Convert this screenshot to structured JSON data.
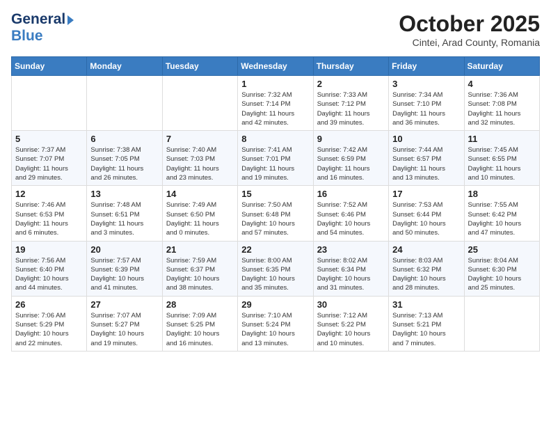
{
  "header": {
    "logo_general": "General",
    "logo_blue": "Blue",
    "month_title": "October 2025",
    "subtitle": "Cintei, Arad County, Romania"
  },
  "calendar": {
    "weekdays": [
      "Sunday",
      "Monday",
      "Tuesday",
      "Wednesday",
      "Thursday",
      "Friday",
      "Saturday"
    ],
    "weeks": [
      [
        {
          "day": "",
          "info": ""
        },
        {
          "day": "",
          "info": ""
        },
        {
          "day": "",
          "info": ""
        },
        {
          "day": "1",
          "info": "Sunrise: 7:32 AM\nSunset: 7:14 PM\nDaylight: 11 hours\nand 42 minutes."
        },
        {
          "day": "2",
          "info": "Sunrise: 7:33 AM\nSunset: 7:12 PM\nDaylight: 11 hours\nand 39 minutes."
        },
        {
          "day": "3",
          "info": "Sunrise: 7:34 AM\nSunset: 7:10 PM\nDaylight: 11 hours\nand 36 minutes."
        },
        {
          "day": "4",
          "info": "Sunrise: 7:36 AM\nSunset: 7:08 PM\nDaylight: 11 hours\nand 32 minutes."
        }
      ],
      [
        {
          "day": "5",
          "info": "Sunrise: 7:37 AM\nSunset: 7:07 PM\nDaylight: 11 hours\nand 29 minutes."
        },
        {
          "day": "6",
          "info": "Sunrise: 7:38 AM\nSunset: 7:05 PM\nDaylight: 11 hours\nand 26 minutes."
        },
        {
          "day": "7",
          "info": "Sunrise: 7:40 AM\nSunset: 7:03 PM\nDaylight: 11 hours\nand 23 minutes."
        },
        {
          "day": "8",
          "info": "Sunrise: 7:41 AM\nSunset: 7:01 PM\nDaylight: 11 hours\nand 19 minutes."
        },
        {
          "day": "9",
          "info": "Sunrise: 7:42 AM\nSunset: 6:59 PM\nDaylight: 11 hours\nand 16 minutes."
        },
        {
          "day": "10",
          "info": "Sunrise: 7:44 AM\nSunset: 6:57 PM\nDaylight: 11 hours\nand 13 minutes."
        },
        {
          "day": "11",
          "info": "Sunrise: 7:45 AM\nSunset: 6:55 PM\nDaylight: 11 hours\nand 10 minutes."
        }
      ],
      [
        {
          "day": "12",
          "info": "Sunrise: 7:46 AM\nSunset: 6:53 PM\nDaylight: 11 hours\nand 6 minutes."
        },
        {
          "day": "13",
          "info": "Sunrise: 7:48 AM\nSunset: 6:51 PM\nDaylight: 11 hours\nand 3 minutes."
        },
        {
          "day": "14",
          "info": "Sunrise: 7:49 AM\nSunset: 6:50 PM\nDaylight: 11 hours\nand 0 minutes."
        },
        {
          "day": "15",
          "info": "Sunrise: 7:50 AM\nSunset: 6:48 PM\nDaylight: 10 hours\nand 57 minutes."
        },
        {
          "day": "16",
          "info": "Sunrise: 7:52 AM\nSunset: 6:46 PM\nDaylight: 10 hours\nand 54 minutes."
        },
        {
          "day": "17",
          "info": "Sunrise: 7:53 AM\nSunset: 6:44 PM\nDaylight: 10 hours\nand 50 minutes."
        },
        {
          "day": "18",
          "info": "Sunrise: 7:55 AM\nSunset: 6:42 PM\nDaylight: 10 hours\nand 47 minutes."
        }
      ],
      [
        {
          "day": "19",
          "info": "Sunrise: 7:56 AM\nSunset: 6:40 PM\nDaylight: 10 hours\nand 44 minutes."
        },
        {
          "day": "20",
          "info": "Sunrise: 7:57 AM\nSunset: 6:39 PM\nDaylight: 10 hours\nand 41 minutes."
        },
        {
          "day": "21",
          "info": "Sunrise: 7:59 AM\nSunset: 6:37 PM\nDaylight: 10 hours\nand 38 minutes."
        },
        {
          "day": "22",
          "info": "Sunrise: 8:00 AM\nSunset: 6:35 PM\nDaylight: 10 hours\nand 35 minutes."
        },
        {
          "day": "23",
          "info": "Sunrise: 8:02 AM\nSunset: 6:34 PM\nDaylight: 10 hours\nand 31 minutes."
        },
        {
          "day": "24",
          "info": "Sunrise: 8:03 AM\nSunset: 6:32 PM\nDaylight: 10 hours\nand 28 minutes."
        },
        {
          "day": "25",
          "info": "Sunrise: 8:04 AM\nSunset: 6:30 PM\nDaylight: 10 hours\nand 25 minutes."
        }
      ],
      [
        {
          "day": "26",
          "info": "Sunrise: 7:06 AM\nSunset: 5:29 PM\nDaylight: 10 hours\nand 22 minutes."
        },
        {
          "day": "27",
          "info": "Sunrise: 7:07 AM\nSunset: 5:27 PM\nDaylight: 10 hours\nand 19 minutes."
        },
        {
          "day": "28",
          "info": "Sunrise: 7:09 AM\nSunset: 5:25 PM\nDaylight: 10 hours\nand 16 minutes."
        },
        {
          "day": "29",
          "info": "Sunrise: 7:10 AM\nSunset: 5:24 PM\nDaylight: 10 hours\nand 13 minutes."
        },
        {
          "day": "30",
          "info": "Sunrise: 7:12 AM\nSunset: 5:22 PM\nDaylight: 10 hours\nand 10 minutes."
        },
        {
          "day": "31",
          "info": "Sunrise: 7:13 AM\nSunset: 5:21 PM\nDaylight: 10 hours\nand 7 minutes."
        },
        {
          "day": "",
          "info": ""
        }
      ]
    ]
  }
}
